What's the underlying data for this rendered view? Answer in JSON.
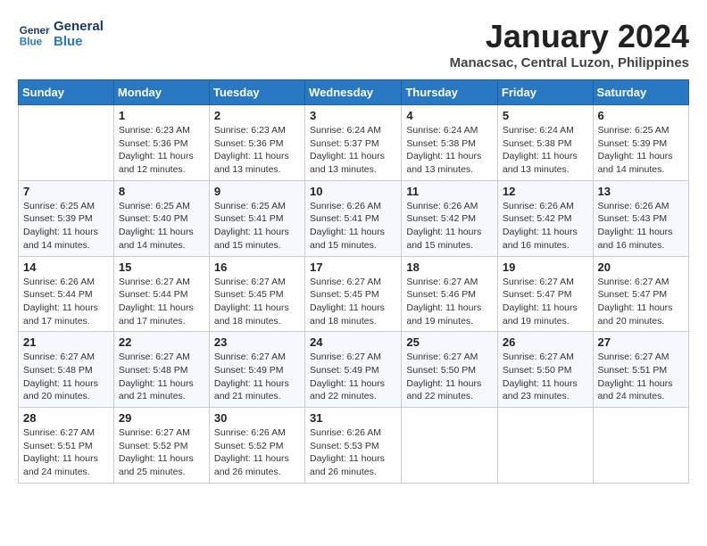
{
  "logo": {
    "line1": "General",
    "line2": "Blue"
  },
  "title": "January 2024",
  "location": "Manacsac, Central Luzon, Philippines",
  "header_days": [
    "Sunday",
    "Monday",
    "Tuesday",
    "Wednesday",
    "Thursday",
    "Friday",
    "Saturday"
  ],
  "weeks": [
    [
      {
        "day": "",
        "info": ""
      },
      {
        "day": "1",
        "info": "Sunrise: 6:23 AM\nSunset: 5:36 PM\nDaylight: 11 hours\nand 12 minutes."
      },
      {
        "day": "2",
        "info": "Sunrise: 6:23 AM\nSunset: 5:36 PM\nDaylight: 11 hours\nand 13 minutes."
      },
      {
        "day": "3",
        "info": "Sunrise: 6:24 AM\nSunset: 5:37 PM\nDaylight: 11 hours\nand 13 minutes."
      },
      {
        "day": "4",
        "info": "Sunrise: 6:24 AM\nSunset: 5:38 PM\nDaylight: 11 hours\nand 13 minutes."
      },
      {
        "day": "5",
        "info": "Sunrise: 6:24 AM\nSunset: 5:38 PM\nDaylight: 11 hours\nand 13 minutes."
      },
      {
        "day": "6",
        "info": "Sunrise: 6:25 AM\nSunset: 5:39 PM\nDaylight: 11 hours\nand 14 minutes."
      }
    ],
    [
      {
        "day": "7",
        "info": "Sunrise: 6:25 AM\nSunset: 5:39 PM\nDaylight: 11 hours\nand 14 minutes."
      },
      {
        "day": "8",
        "info": "Sunrise: 6:25 AM\nSunset: 5:40 PM\nDaylight: 11 hours\nand 14 minutes."
      },
      {
        "day": "9",
        "info": "Sunrise: 6:25 AM\nSunset: 5:41 PM\nDaylight: 11 hours\nand 15 minutes."
      },
      {
        "day": "10",
        "info": "Sunrise: 6:26 AM\nSunset: 5:41 PM\nDaylight: 11 hours\nand 15 minutes."
      },
      {
        "day": "11",
        "info": "Sunrise: 6:26 AM\nSunset: 5:42 PM\nDaylight: 11 hours\nand 15 minutes."
      },
      {
        "day": "12",
        "info": "Sunrise: 6:26 AM\nSunset: 5:42 PM\nDaylight: 11 hours\nand 16 minutes."
      },
      {
        "day": "13",
        "info": "Sunrise: 6:26 AM\nSunset: 5:43 PM\nDaylight: 11 hours\nand 16 minutes."
      }
    ],
    [
      {
        "day": "14",
        "info": "Sunrise: 6:26 AM\nSunset: 5:44 PM\nDaylight: 11 hours\nand 17 minutes."
      },
      {
        "day": "15",
        "info": "Sunrise: 6:27 AM\nSunset: 5:44 PM\nDaylight: 11 hours\nand 17 minutes."
      },
      {
        "day": "16",
        "info": "Sunrise: 6:27 AM\nSunset: 5:45 PM\nDaylight: 11 hours\nand 18 minutes."
      },
      {
        "day": "17",
        "info": "Sunrise: 6:27 AM\nSunset: 5:45 PM\nDaylight: 11 hours\nand 18 minutes."
      },
      {
        "day": "18",
        "info": "Sunrise: 6:27 AM\nSunset: 5:46 PM\nDaylight: 11 hours\nand 19 minutes."
      },
      {
        "day": "19",
        "info": "Sunrise: 6:27 AM\nSunset: 5:47 PM\nDaylight: 11 hours\nand 19 minutes."
      },
      {
        "day": "20",
        "info": "Sunrise: 6:27 AM\nSunset: 5:47 PM\nDaylight: 11 hours\nand 20 minutes."
      }
    ],
    [
      {
        "day": "21",
        "info": "Sunrise: 6:27 AM\nSunset: 5:48 PM\nDaylight: 11 hours\nand 20 minutes."
      },
      {
        "day": "22",
        "info": "Sunrise: 6:27 AM\nSunset: 5:48 PM\nDaylight: 11 hours\nand 21 minutes."
      },
      {
        "day": "23",
        "info": "Sunrise: 6:27 AM\nSunset: 5:49 PM\nDaylight: 11 hours\nand 21 minutes."
      },
      {
        "day": "24",
        "info": "Sunrise: 6:27 AM\nSunset: 5:49 PM\nDaylight: 11 hours\nand 22 minutes."
      },
      {
        "day": "25",
        "info": "Sunrise: 6:27 AM\nSunset: 5:50 PM\nDaylight: 11 hours\nand 22 minutes."
      },
      {
        "day": "26",
        "info": "Sunrise: 6:27 AM\nSunset: 5:50 PM\nDaylight: 11 hours\nand 23 minutes."
      },
      {
        "day": "27",
        "info": "Sunrise: 6:27 AM\nSunset: 5:51 PM\nDaylight: 11 hours\nand 24 minutes."
      }
    ],
    [
      {
        "day": "28",
        "info": "Sunrise: 6:27 AM\nSunset: 5:51 PM\nDaylight: 11 hours\nand 24 minutes."
      },
      {
        "day": "29",
        "info": "Sunrise: 6:27 AM\nSunset: 5:52 PM\nDaylight: 11 hours\nand 25 minutes."
      },
      {
        "day": "30",
        "info": "Sunrise: 6:26 AM\nSunset: 5:52 PM\nDaylight: 11 hours\nand 26 minutes."
      },
      {
        "day": "31",
        "info": "Sunrise: 6:26 AM\nSunset: 5:53 PM\nDaylight: 11 hours\nand 26 minutes."
      },
      {
        "day": "",
        "info": ""
      },
      {
        "day": "",
        "info": ""
      },
      {
        "day": "",
        "info": ""
      }
    ]
  ]
}
